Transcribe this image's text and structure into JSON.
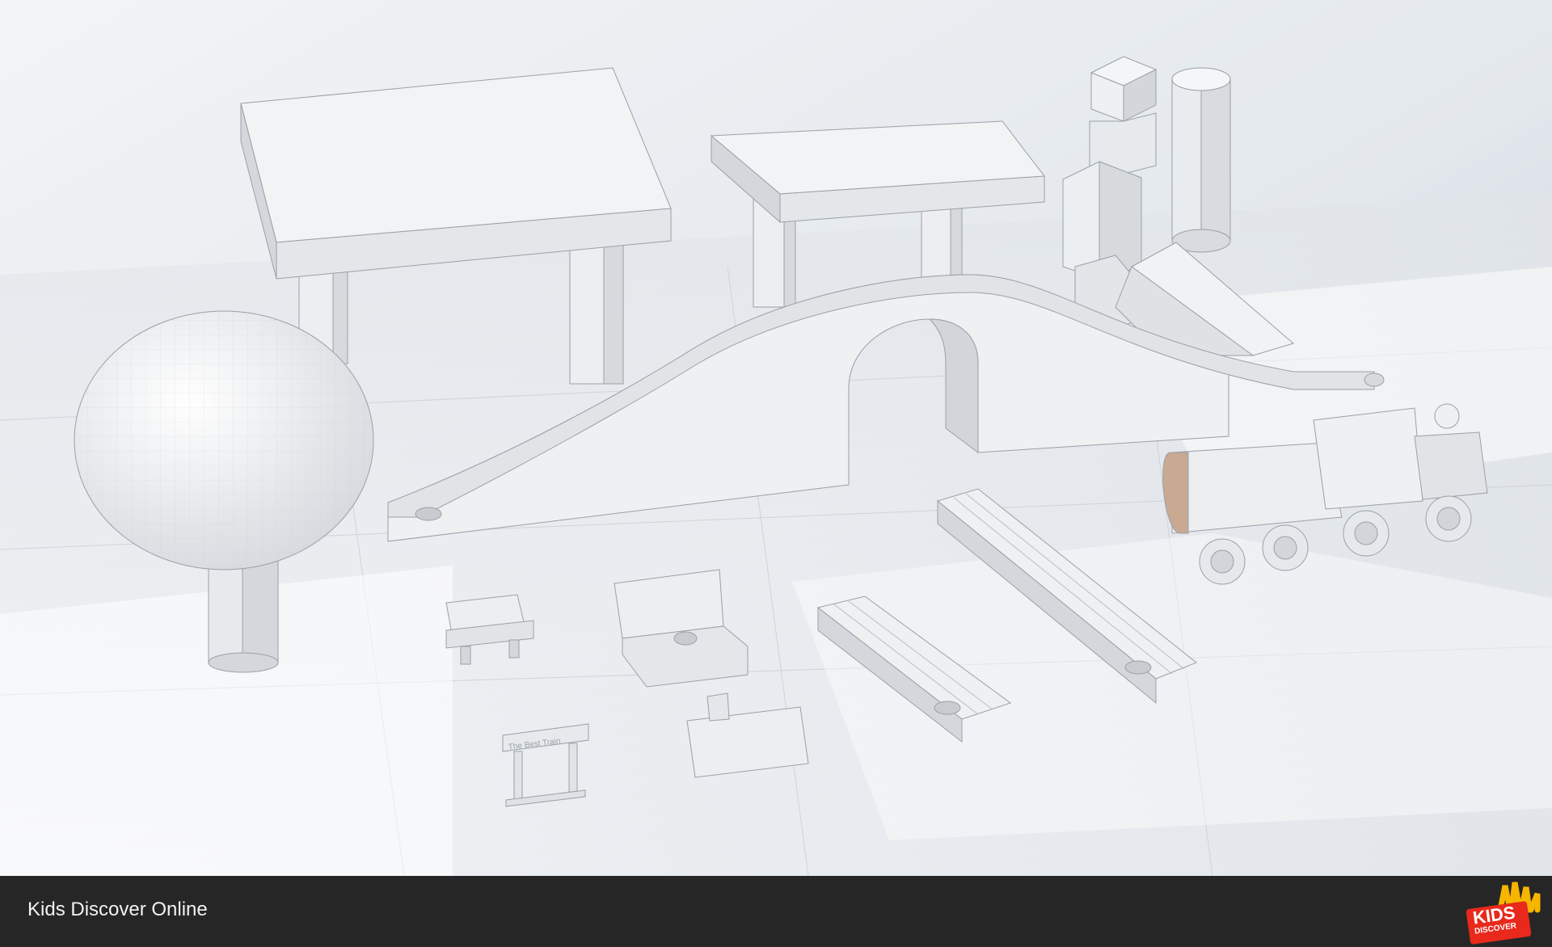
{
  "footer": {
    "title": "Kids Discover Online",
    "logo_line1": "KIDS",
    "logo_line2": "DISCOVER"
  },
  "sign": {
    "text": "The Best Train"
  },
  "colors": {
    "footer_bg": "#262626",
    "logo_red": "#e8291c",
    "logo_yellow": "#f7b500"
  }
}
